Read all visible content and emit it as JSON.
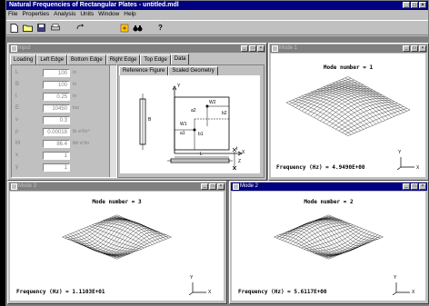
{
  "app": {
    "title": "Natural Frequencies of Rectangular Plates - untitled.mdl",
    "menu": [
      "File",
      "Properties",
      "Analysis",
      "Units",
      "Window",
      "Help"
    ]
  },
  "input_window": {
    "title": "Input",
    "tabs": [
      "Loading",
      "Left Edge",
      "Bottom Edge",
      "Right Edge",
      "Top Edge",
      "Data"
    ],
    "subtabs": [
      "Reference Figure",
      "Scaled Geometry"
    ],
    "fields": [
      {
        "label": "L",
        "value": "100",
        "unit": "in"
      },
      {
        "label": "B",
        "value": "100",
        "unit": "in"
      },
      {
        "label": "t",
        "value": "0.25",
        "unit": "in"
      },
      {
        "label": "E",
        "value": "10450",
        "unit": "ksi"
      },
      {
        "label": "v",
        "value": "0.3",
        "unit": ""
      },
      {
        "label": "ρ",
        "value": "0.00018",
        "unit": "lb·s²/in⁴"
      },
      {
        "label": "M",
        "value": "86.4",
        "unit": "lbf·s²/in"
      },
      {
        "label": "x",
        "value": "1",
        "unit": ""
      },
      {
        "label": "y",
        "value": "1",
        "unit": ""
      }
    ],
    "figure_labels": {
      "y": "Y",
      "x": "X",
      "z": "Z",
      "B": "B",
      "L": "L",
      "W2": "W2",
      "a2": "a2",
      "W1": "W1",
      "a1": "a1",
      "b1": "b1",
      "b2": "b2",
      "t": "t"
    }
  },
  "mode_windows": [
    {
      "title": "Mode 1",
      "heading": "Mode number = 1",
      "frequency": "Frequency (Hz) = 4.9490E+00"
    },
    {
      "title": "Mode 3",
      "heading": "Mode number = 3",
      "frequency": "Frequency (Hz) = 1.1103E+01"
    },
    {
      "title": "Mode 2",
      "heading": "Mode number = 2",
      "frequency": "Frequency (Hz) = 5.6117E+00"
    }
  ],
  "axis": {
    "x": "X",
    "y": "Y"
  }
}
